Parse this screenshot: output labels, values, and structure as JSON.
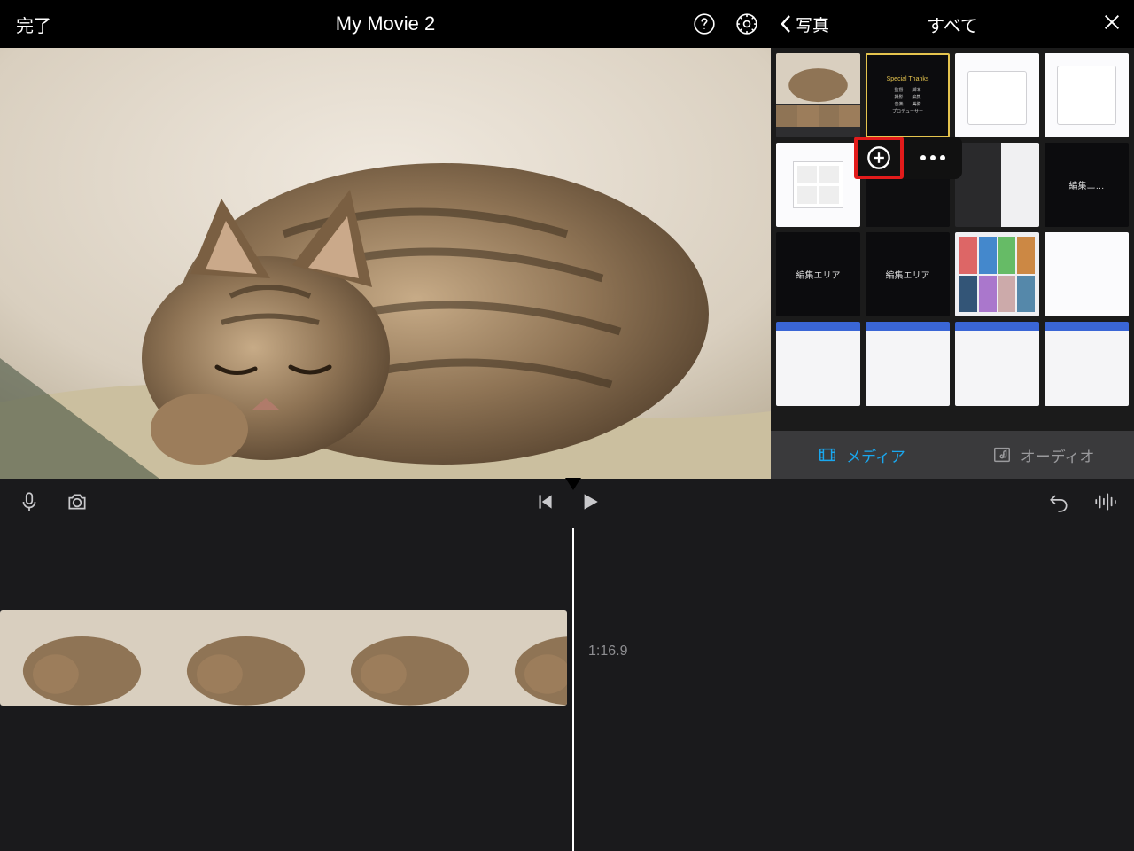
{
  "header": {
    "done_label": "完了",
    "title": "My Movie 2"
  },
  "media": {
    "back_label": "写真",
    "title": "すべて",
    "credits_title": "Special Thanks",
    "edit_area_label": "編集エリア",
    "tabs": {
      "media": "メディア",
      "audio": "オーディオ"
    }
  },
  "timeline": {
    "duration": "1:16.9"
  }
}
